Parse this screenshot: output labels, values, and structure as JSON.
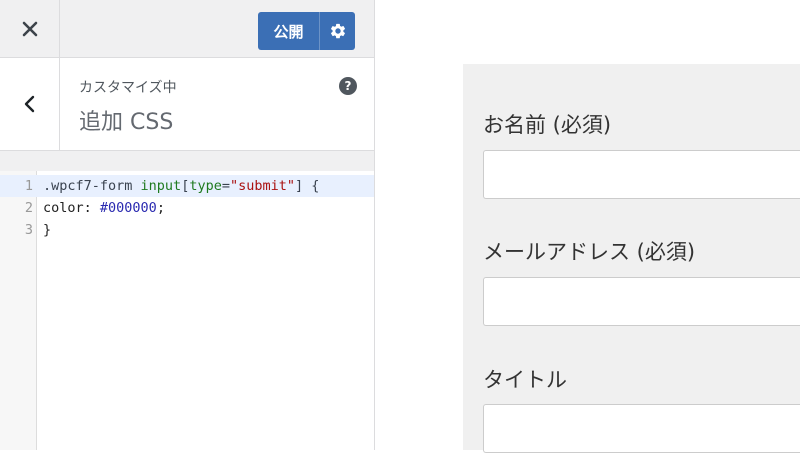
{
  "sidebar": {
    "close_label": "×",
    "publish_label": "公開",
    "customizing_label": "カスタマイズ中",
    "section_title": "追加 CSS",
    "help_label": "?"
  },
  "editor": {
    "lines": [
      {
        "num": "1",
        "parts": [
          {
            "text": ".wpcf7-form ",
            "cls": "tok-sel"
          },
          {
            "text": "input",
            "cls": "tok-attr"
          },
          {
            "text": "[",
            "cls": "tok-sel"
          },
          {
            "text": "type",
            "cls": "tok-attr"
          },
          {
            "text": "=",
            "cls": "tok-sel"
          },
          {
            "text": "\"submit\"",
            "cls": "tok-str"
          },
          {
            "text": "] {",
            "cls": "tok-sel"
          }
        ]
      },
      {
        "num": "2",
        "parts": [
          {
            "text": "color",
            "cls": "tok-prop"
          },
          {
            "text": ": ",
            "cls": "tok-prop"
          },
          {
            "text": "#000000",
            "cls": "tok-val"
          },
          {
            "text": ";",
            "cls": "tok-prop"
          }
        ]
      },
      {
        "num": "3",
        "parts": [
          {
            "text": "}",
            "cls": "tok-prop"
          }
        ]
      }
    ]
  },
  "form": {
    "name_label": "お名前 (必須)",
    "email_label": "メールアドレス (必須)",
    "subject_label": "タイトル",
    "name_value": "",
    "email_value": "",
    "subject_value": ""
  },
  "colors": {
    "publish_bg": "#3b6fb5",
    "form_panel_bg": "#f0f0f0",
    "active_line_bg": "#e8f0fe"
  }
}
